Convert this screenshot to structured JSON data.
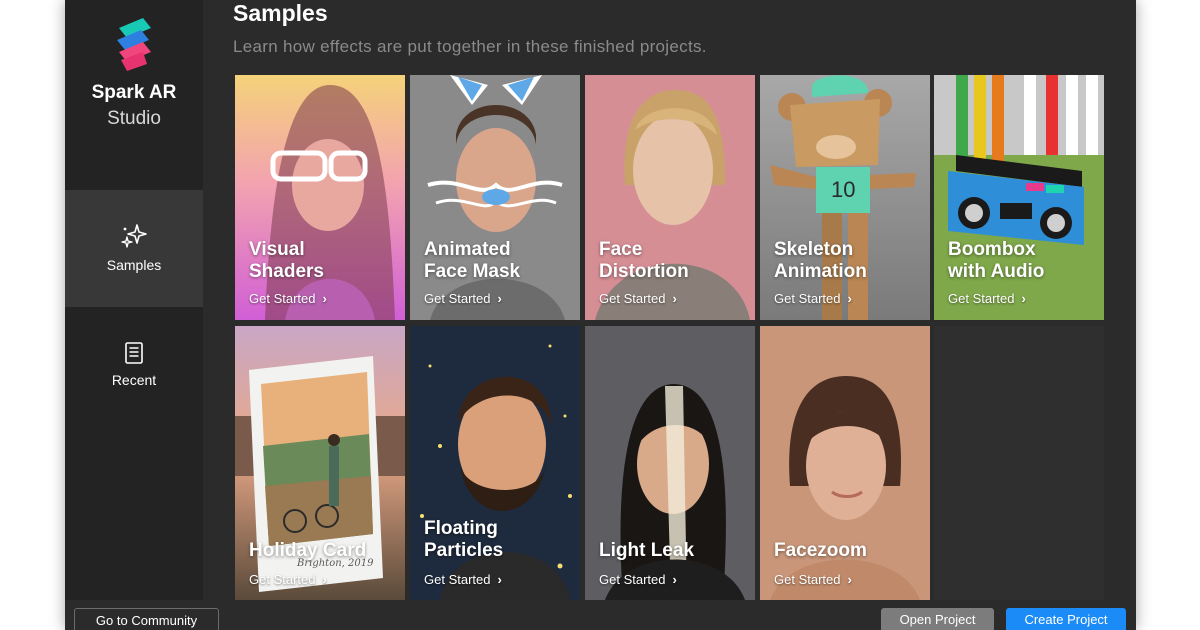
{
  "app": {
    "name_line1": "Spark AR",
    "name_line2": "Studio"
  },
  "sidebar": {
    "items": [
      {
        "label": "Samples",
        "icon": "sparkle-icon",
        "active": true
      },
      {
        "label": "Recent",
        "icon": "document-icon",
        "active": false
      }
    ]
  },
  "main": {
    "title": "Samples",
    "subtitle": "Learn how effects are put together in these finished projects."
  },
  "cards": [
    {
      "title_line1": "Visual",
      "title_line2": "Shaders",
      "cta": "Get Started"
    },
    {
      "title_line1": "Animated",
      "title_line2": "Face Mask",
      "cta": "Get Started"
    },
    {
      "title_line1": "Face",
      "title_line2": "Distortion",
      "cta": "Get Started"
    },
    {
      "title_line1": "Skeleton",
      "title_line2": "Animation",
      "cta": "Get Started"
    },
    {
      "title_line1": "Boombox",
      "title_line2": "with Audio",
      "cta": "Get Started"
    },
    {
      "title_line1": "Holiday Card",
      "title_line2": "",
      "cta": "Get Started",
      "handwriting": "Brighton, 2019"
    },
    {
      "title_line1": "Floating",
      "title_line2": "Particles",
      "cta": "Get Started"
    },
    {
      "title_line1": "Light Leak",
      "title_line2": "",
      "cta": "Get Started"
    },
    {
      "title_line1": "Facezoom",
      "title_line2": "",
      "cta": "Get Started"
    }
  ],
  "footer": {
    "community_label": "Go to Community",
    "open_label": "Open Project",
    "create_label": "Create Project"
  },
  "colors": {
    "window_bg": "#2b2b2b",
    "sidebar_bg": "#232323",
    "sidebar_active_bg": "#383838",
    "primary_button": "#1b8cf7",
    "secondary_button": "#7c7c7c"
  }
}
